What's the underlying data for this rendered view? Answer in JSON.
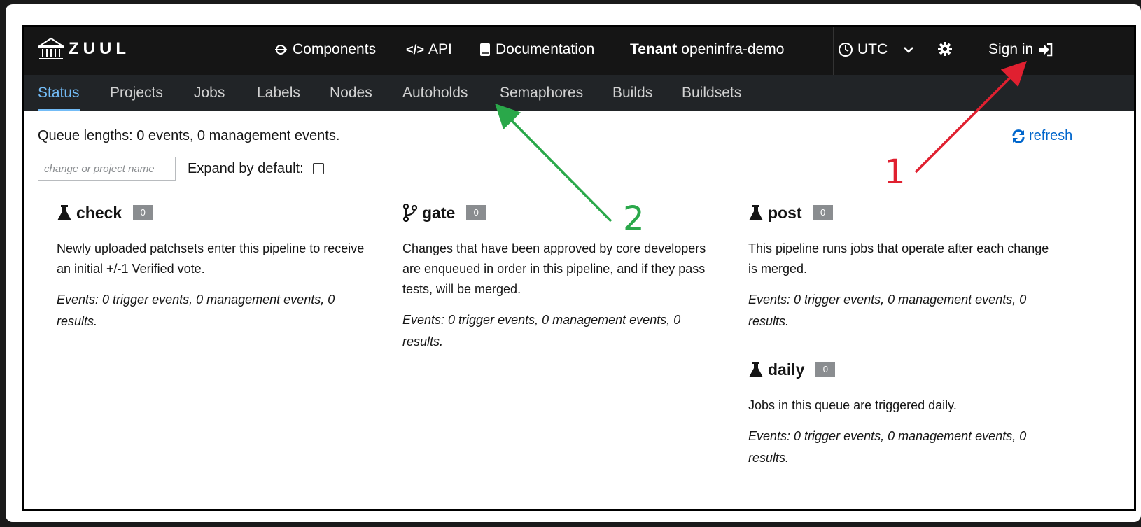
{
  "brand": {
    "logo_text": "ZUUL"
  },
  "topnav": {
    "components": "Components",
    "api": "API",
    "documentation": "Documentation",
    "tenant_label": "Tenant",
    "tenant_name": "openinfra-demo",
    "timezone": "UTC",
    "sign_in": "Sign in"
  },
  "tabs": [
    "Status",
    "Projects",
    "Jobs",
    "Labels",
    "Nodes",
    "Autoholds",
    "Semaphores",
    "Builds",
    "Buildsets"
  ],
  "active_tab": "Status",
  "status": {
    "queue_lengths": "Queue lengths: 0 events, 0 management events.",
    "refresh_label": "refresh",
    "filter_placeholder": "change or project name",
    "expand_label": "Expand by default:"
  },
  "pipelines": [
    {
      "name": "check",
      "icon": "flask-icon",
      "count": "0",
      "description": "Newly uploaded patchsets enter this pipeline to receive an initial +/-1 Verified vote.",
      "events": "Events: 0 trigger events, 0 management events, 0 results."
    },
    {
      "name": "gate",
      "icon": "code-branch-icon",
      "count": "0",
      "description": "Changes that have been approved by core developers are enqueued in order in this pipeline, and if they pass tests, will be merged.",
      "events": "Events: 0 trigger events, 0 management events, 0 results."
    },
    {
      "name": "post",
      "icon": "flask-icon",
      "count": "0",
      "description": "This pipeline runs jobs that operate after each change is merged.",
      "events": "Events: 0 trigger events, 0 management events, 0 results."
    },
    {
      "name": "daily",
      "icon": "flask-icon",
      "count": "0",
      "description": "Jobs in this queue are triggered daily.",
      "events": "Events: 0 trigger events, 0 management events, 0 results."
    }
  ],
  "annotations": {
    "one": {
      "label": "1",
      "color": "#e02030"
    },
    "two": {
      "label": "2",
      "color": "#2aa84a"
    }
  },
  "colors": {
    "masthead": "#151515",
    "subnav": "#212427",
    "active_tab": "#73bcf7",
    "link": "#0066cc"
  }
}
